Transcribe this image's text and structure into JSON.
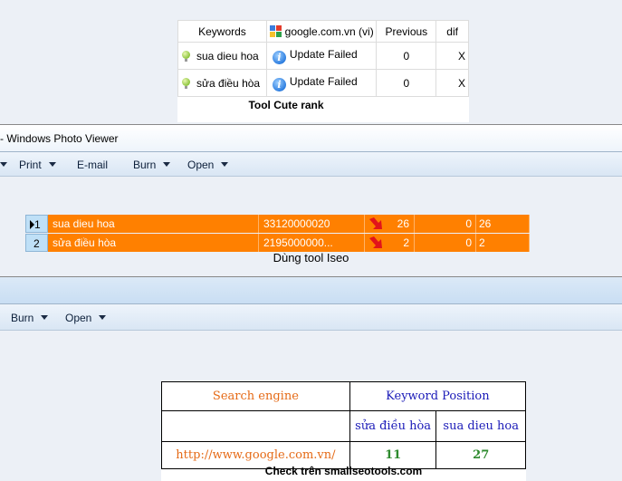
{
  "cute_rank": {
    "headers": {
      "keywords": "Keywords",
      "engine": "google.com.vn (vi)",
      "previous": "Previous",
      "dif": "dif"
    },
    "rows": [
      {
        "keyword": "sua dieu hoa",
        "status": "Update Failed",
        "previous": "0",
        "dif": "X"
      },
      {
        "keyword": "sửa điều hòa",
        "status": "Update Failed",
        "previous": "0",
        "dif": "X"
      }
    ],
    "caption": "Tool Cute rank"
  },
  "window1": {
    "title": "- Windows Photo Viewer",
    "menu": {
      "print": "Print",
      "email": "E-mail",
      "burn": "Burn",
      "open": "Open"
    }
  },
  "iseo": {
    "rows": [
      {
        "num": "1",
        "keyword": "sua dieu hoa",
        "value": "33120000020",
        "a": "26",
        "b": "0",
        "c": "26"
      },
      {
        "num": "2",
        "keyword": "sửa điều hòa",
        "value": "2195000000...",
        "a": "2",
        "b": "0",
        "c": "2"
      }
    ],
    "caption": "Dùng tool Iseo"
  },
  "window2": {
    "menu": {
      "burn": "Burn",
      "open": "Open"
    }
  },
  "smallseo": {
    "header_engine": "Search engine",
    "header_position": "Keyword Position",
    "kw1": "sửa điều hòa",
    "kw2": "sua dieu hoa",
    "url": "http://www.google.com.vn/",
    "pos1": "11",
    "pos2": "27",
    "caption": "Check trên smallseotools.com"
  },
  "colors": {
    "orange_row": "#ff8000",
    "window_bg": "#ecf0f6",
    "menubar": "#d9e6f4"
  }
}
